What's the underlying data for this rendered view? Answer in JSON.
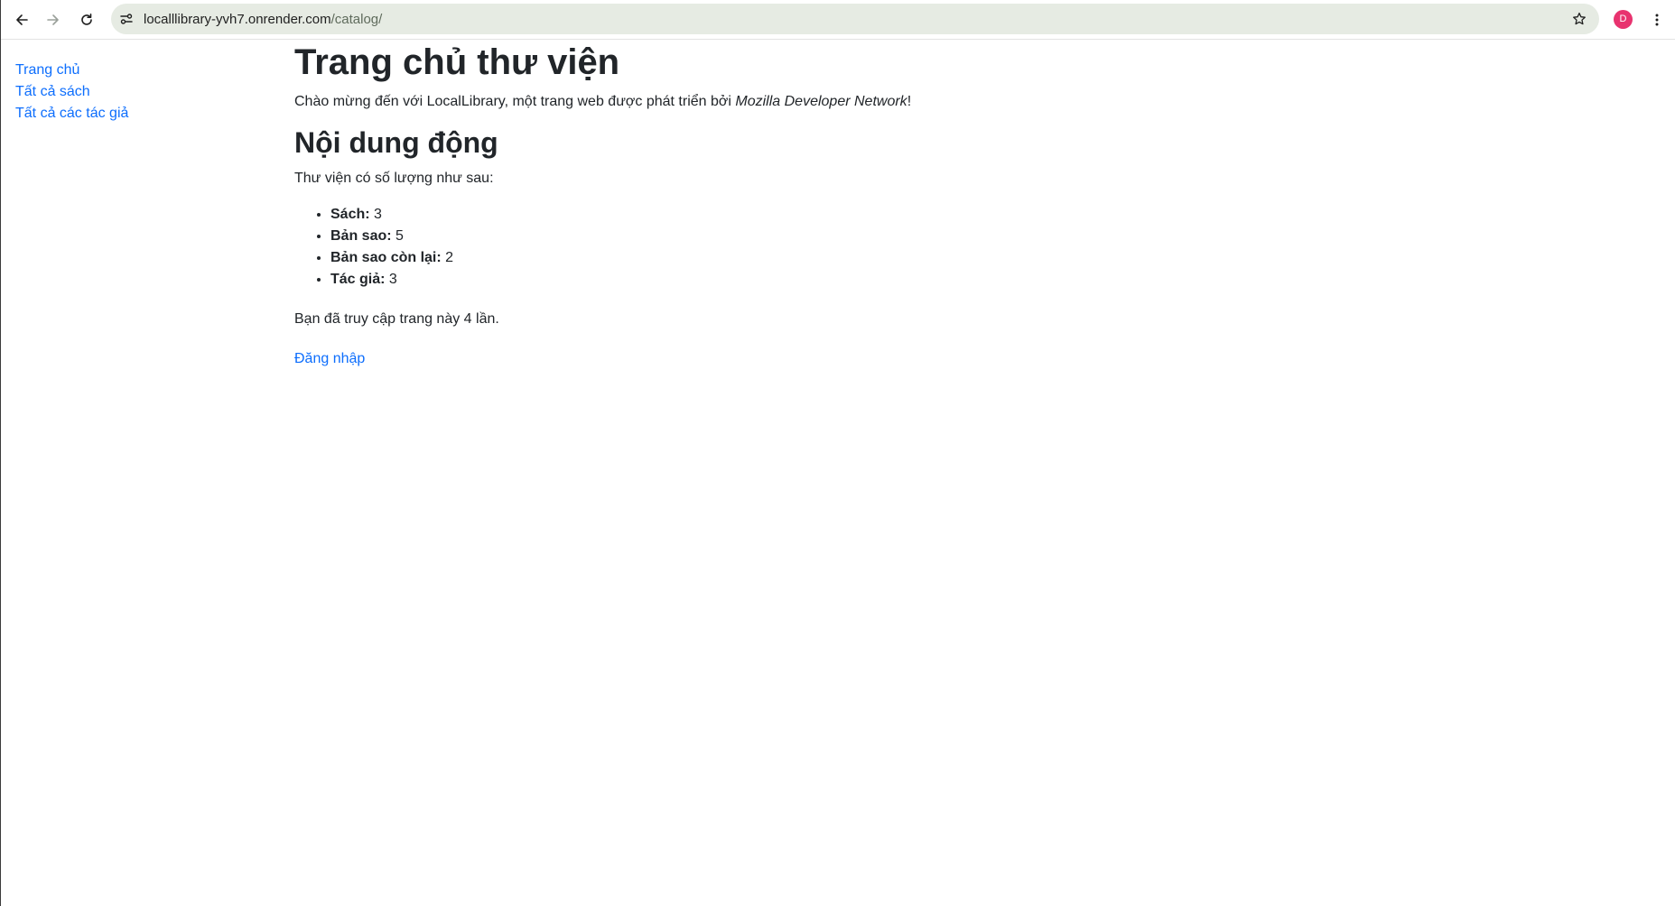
{
  "browser": {
    "url_host": "localllibrary-yvh7.onrender.com",
    "url_path": "/catalog/",
    "avatar_letter": "D",
    "icons": {
      "back": "back-arrow-icon",
      "forward": "forward-arrow-icon",
      "reload": "reload-icon",
      "site_info": "site-settings-icon",
      "bookmark": "star-icon",
      "menu": "kebab-menu-icon"
    },
    "colors": {
      "omnibox_bg": "#e6ebe3",
      "avatar_bg": "#e8336f"
    }
  },
  "sidebar": {
    "items": [
      {
        "label": "Trang chủ"
      },
      {
        "label": "Tất cả sách"
      },
      {
        "label": "Tất cả các tác giả"
      }
    ]
  },
  "main": {
    "title": "Trang chủ thư viện",
    "intro_prefix": "Chào mừng đến với LocalLibrary, một trang web được phát triển bởi ",
    "intro_emphasis": "Mozilla Developer Network",
    "intro_suffix": "!",
    "section_title": "Nội dung động",
    "summary_text": "Thư viện có số lượng như sau:",
    "stats": [
      {
        "label": "Sách:",
        "value": "3"
      },
      {
        "label": "Bản sao:",
        "value": "5"
      },
      {
        "label": "Bản sao còn lại:",
        "value": "2"
      },
      {
        "label": "Tác giả:",
        "value": "3"
      }
    ],
    "visits_text": "Bạn đã truy cập trang này 4 lần.",
    "login_label": "Đăng nhập"
  },
  "colors": {
    "link": "#0d6efd",
    "text": "#212529"
  }
}
